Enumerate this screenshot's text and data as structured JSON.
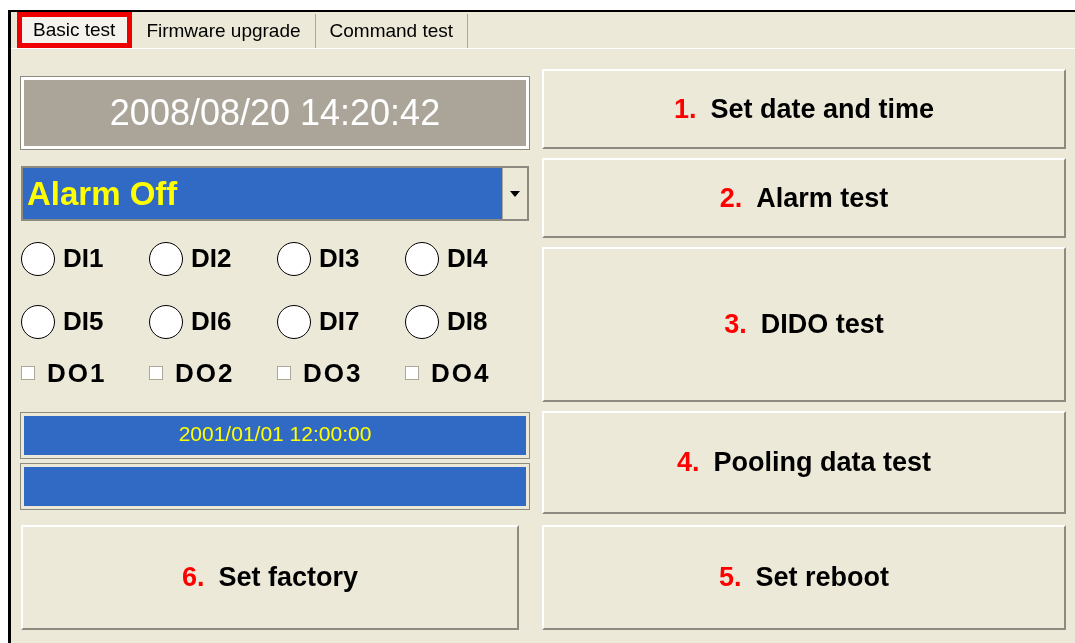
{
  "tabs": [
    {
      "label": "Basic test",
      "selected": true,
      "highlighted": true
    },
    {
      "label": "Firmware upgrade",
      "selected": false,
      "highlighted": false
    },
    {
      "label": "Command test",
      "selected": false,
      "highlighted": false
    }
  ],
  "clock_display": "2008/08/20 14:20:42",
  "alarm_dropdown": {
    "value": "Alarm Off"
  },
  "digital_inputs": [
    {
      "label": "DI1",
      "selected": false
    },
    {
      "label": "DI2",
      "selected": false
    },
    {
      "label": "DI3",
      "selected": false
    },
    {
      "label": "DI4",
      "selected": false
    },
    {
      "label": "DI5",
      "selected": false
    },
    {
      "label": "DI6",
      "selected": false
    },
    {
      "label": "DI7",
      "selected": false
    },
    {
      "label": "DI8",
      "selected": false
    }
  ],
  "digital_outputs": [
    {
      "label": "DO1",
      "checked": false
    },
    {
      "label": "DO2",
      "checked": false
    },
    {
      "label": "DO3",
      "checked": false
    },
    {
      "label": "DO4",
      "checked": false
    }
  ],
  "status_fields": [
    "2001/01/01 12:00:00"
  ],
  "right_buttons": [
    {
      "number": "1.",
      "label": "Set date and time"
    },
    {
      "number": "2.",
      "label": "Alarm test"
    },
    {
      "number": "3.",
      "label": "DIDO test"
    },
    {
      "number": "4.",
      "label": "Pooling data test"
    }
  ],
  "bottom_buttons": [
    {
      "number": "6.",
      "label": "Set factory"
    },
    {
      "number": "5.",
      "label": "Set reboot"
    }
  ]
}
